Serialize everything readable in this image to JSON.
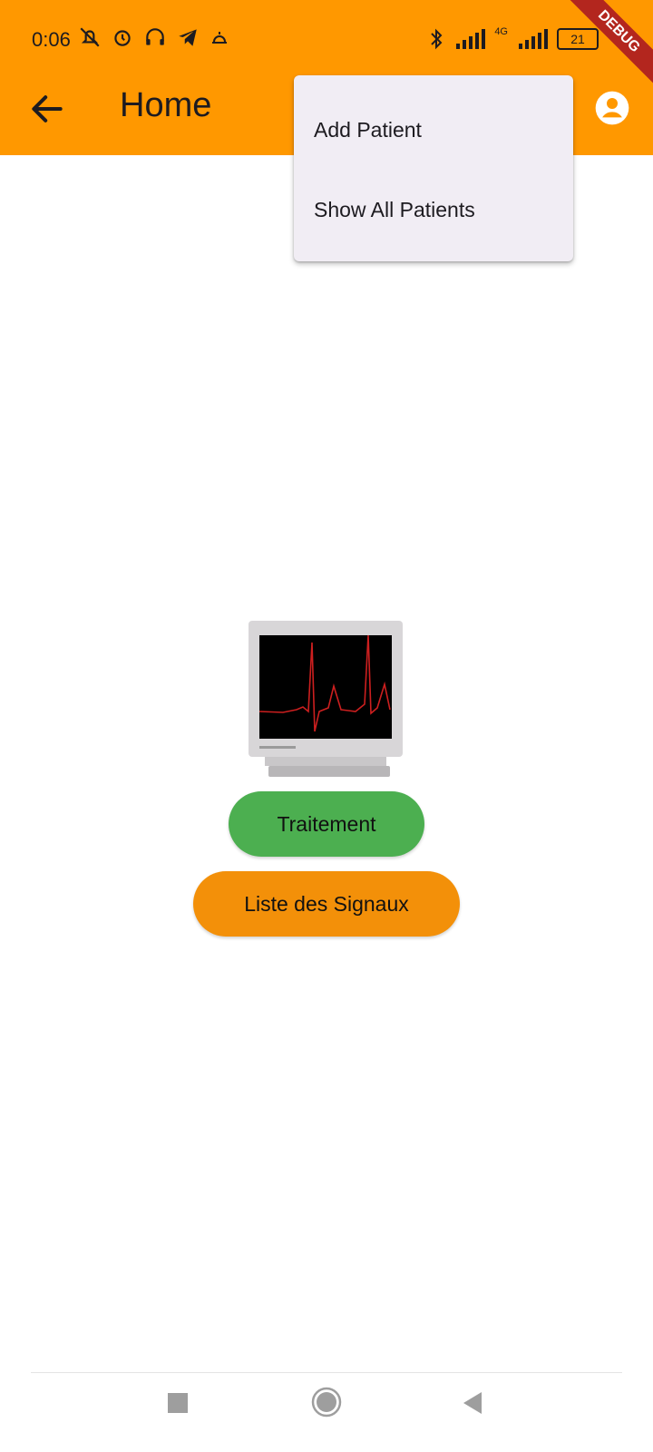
{
  "status_bar": {
    "time": "0:06",
    "battery": "21",
    "network": "4G",
    "debug_label": "DEBUG"
  },
  "app_bar": {
    "title": "Home",
    "back_icon": "arrow-back-icon",
    "account_icon": "account-circle-icon",
    "color": "#ff9800"
  },
  "popup_menu": {
    "items": [
      {
        "label": "Add Patient"
      },
      {
        "label": "Show All Patients"
      }
    ]
  },
  "main": {
    "image": "ecg-monitor-image",
    "buttons": {
      "traitement": "Traitement",
      "liste_signaux": "Liste des Signaux"
    },
    "colors": {
      "traitement": "#4caf50",
      "liste_signaux": "#f39009"
    }
  },
  "system_nav": {
    "recent_icon": "square-icon",
    "home_icon": "circle-icon",
    "back_icon": "triangle-back-icon"
  }
}
